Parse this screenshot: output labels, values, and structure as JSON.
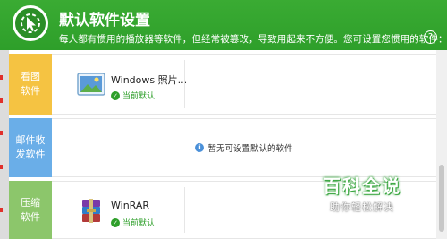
{
  "header": {
    "title": "默认软件设置",
    "subtitle": "每人都有惯用的播放器等软件，但经常被篡改，导致用起来不方便。您可设置您惯用的软件：",
    "help_symbol": "?"
  },
  "sections": [
    {
      "label_line1": "看图",
      "label_line2": "软件",
      "color": "#f5c342",
      "app": {
        "name": "Windows 照片...",
        "status": "当前默认",
        "icon": "photo-viewer-icon"
      }
    },
    {
      "label_line1": "邮件收",
      "label_line2": "发软件",
      "color": "#6aaee8",
      "message": "暂无可设置默认的软件",
      "icon": "info-icon"
    },
    {
      "label_line1": "压缩",
      "label_line2": "软件",
      "color": "#8cc66b",
      "app": {
        "name": "WinRAR",
        "status": "当前默认",
        "icon": "winrar-icon"
      }
    }
  ],
  "watermark": {
    "main": "百科全说",
    "sub": "助你轻松解决"
  },
  "colors": {
    "header_green": "#2e9f2a",
    "status_green": "#2e9f2a",
    "info_blue": "#4a90d9"
  }
}
